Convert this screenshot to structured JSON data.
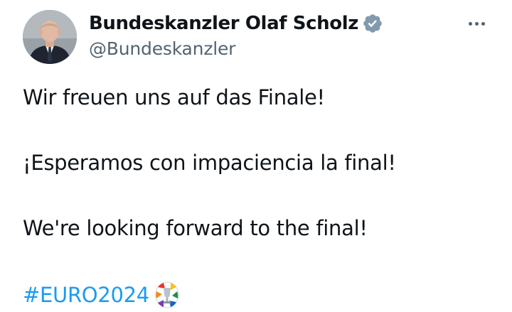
{
  "author": {
    "display_name": "Bundeskanzler Olaf Scholz",
    "handle": "@Bundeskanzler",
    "verified": true,
    "verified_color": "#829aab"
  },
  "menu": {
    "icon": "more-horizontal-icon"
  },
  "tweet": {
    "lines": [
      "Wir freuen uns auf das Finale!",
      "¡Esperamos con impaciencia la final!",
      "We're looking forward to the final!"
    ],
    "hashtag": "#EURO2024",
    "hashtag_emoji": "euro2024-trophy-emoji"
  },
  "colors": {
    "text": "#0f1419",
    "secondary": "#536471",
    "link": "#1d9bf0",
    "background": "#ffffff"
  }
}
